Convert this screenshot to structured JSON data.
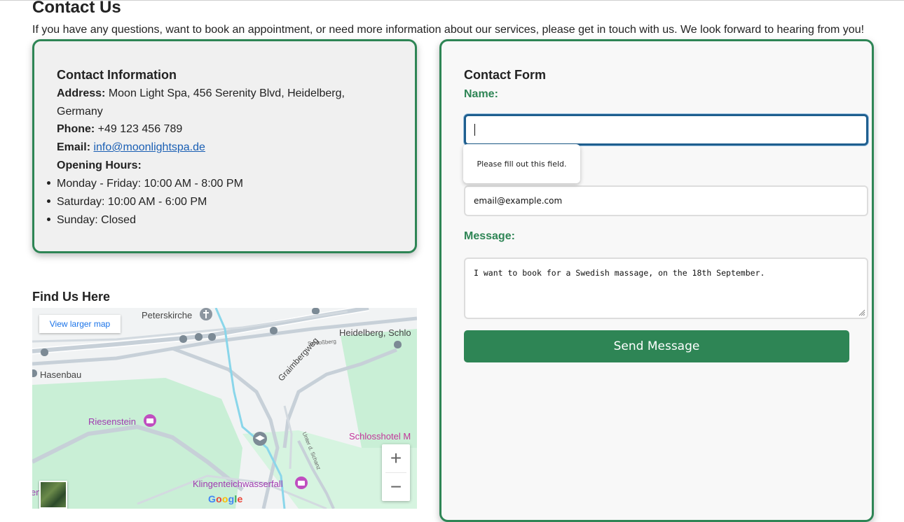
{
  "page": {
    "title": "Contact Us",
    "intro": "If you have any questions, want to book an appointment, or need more information about our services, please get in touch with us. We look forward to hearing from you!"
  },
  "contact_info": {
    "heading": "Contact Information",
    "address_label": "Address:",
    "address_line1": "Moon Light Spa, 456 Serenity Blvd, Heidelberg,",
    "address_line2": "Germany",
    "phone_label": "Phone:",
    "phone": "+49 123 456 789",
    "email_label": "Email:",
    "email": "info@moonlightspa.de",
    "hours_label": "Opening Hours:",
    "hours": [
      "Monday - Friday: 10:00 AM - 8:00 PM",
      "Saturday: 10:00 AM - 6:00 PM",
      "Sunday: Closed"
    ]
  },
  "map": {
    "heading": "Find Us Here",
    "larger_map_link": "View larger map",
    "labels": {
      "peterskirche": "Peterskirche",
      "heidelberg_schloss": "Heidelberg, Schlo",
      "schlossberg": "Schloßberg",
      "hasenbau": "Hasenbau",
      "graimbergweg": "Graimbergweg",
      "riesenstein": "Riesenstein",
      "schlosshotel": "Schlosshotel M",
      "unter_schanz": "Unter d. Schanz",
      "klingenteich": "Klingenteichwasserfall",
      "enkstein": "enkstein)",
      "google": "Google"
    },
    "zoom_in": "+",
    "zoom_out": "−"
  },
  "form": {
    "heading": "Contact Form",
    "name_label": "Name:",
    "name_value": "",
    "validation_tooltip": "Please fill out this field.",
    "email_value": "email@example.com",
    "message_label": "Message:",
    "message_value": "I want to book for a Swedish massage, on the 18th September.",
    "submit_label": "Send Message"
  },
  "colors": {
    "accent": "#2e8555",
    "link": "#1a5fb4",
    "focus_border": "#1f5f8f"
  }
}
